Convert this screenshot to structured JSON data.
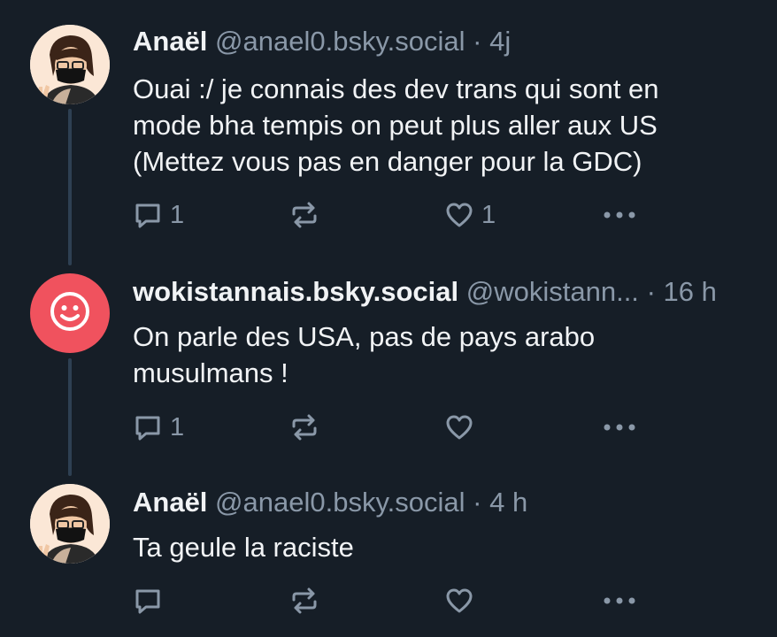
{
  "posts": [
    {
      "author": "Anaël",
      "handle": "@anael0.bsky.social",
      "separator": "·",
      "time": "4j",
      "text_lines": [
        "Ouai :/ je connais des dev trans qui sont en",
        "mode bha tempis on peut plus aller aux US",
        "(Mettez vous pas en danger pour la GDC)"
      ],
      "reply_count": "1",
      "like_count": "1"
    },
    {
      "author": "wokistannais.bsky.social",
      "handle": "@wokistann...",
      "separator": "·",
      "time": "16 h",
      "text_lines": [
        "On parle des USA, pas de pays arabo",
        "musulmans !"
      ],
      "reply_count": "1",
      "like_count": ""
    },
    {
      "author": "Anaël",
      "handle": "@anael0.bsky.social",
      "separator": "·",
      "time": "4 h",
      "text_lines": [
        "Ta geule la raciste"
      ],
      "reply_count": "",
      "like_count": ""
    }
  ],
  "icons": {
    "reply": "reply-icon",
    "repost": "repost-icon",
    "like": "like-icon",
    "more": "more-icon",
    "default_avatar": "smiley-avatar-icon"
  },
  "colors": {
    "background": "#161e27",
    "text": "#f1f3f5",
    "muted": "#8a98a8",
    "thread_line": "#2e4052",
    "default_avatar": "#f0525e"
  }
}
